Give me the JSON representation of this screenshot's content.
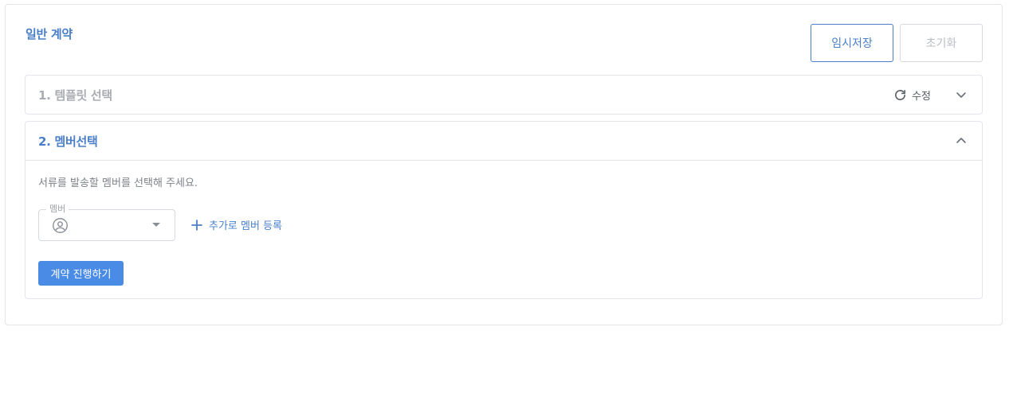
{
  "page": {
    "title": "일반 계약"
  },
  "toolbar": {
    "save_label": "임시저장",
    "reset_label": "초기화"
  },
  "sections": [
    {
      "title": "1. 템플릿 선택",
      "edit_label": "수정",
      "edit_icon": "refresh-icon",
      "expanded": false,
      "toggle_icon": "chevron-down-icon"
    },
    {
      "title": "2. 멤버선택",
      "expanded": true,
      "toggle_icon": "chevron-up-icon",
      "helper_text": "서류를 발송할 멤버를 선택해 주세요.",
      "member_field": {
        "label": "멤버",
        "value": "",
        "icon": "user-circle-icon",
        "dropdown_icon": "caret-down-icon"
      },
      "add_member_label": "추가로 멤버 등록",
      "add_member_icon": "plus-icon",
      "proceed_label": "계약 진행하기"
    }
  ],
  "colors": {
    "accent": "#4a7fc8",
    "primary_button": "#4a8be6",
    "border": "#e3e6ea",
    "muted_text": "#a9adb3"
  }
}
